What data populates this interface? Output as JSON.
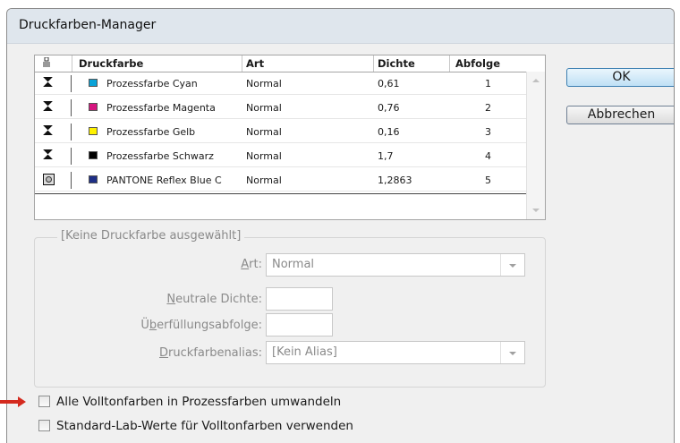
{
  "window": {
    "title": "Druckfarben-Manager"
  },
  "table": {
    "columns": [
      "Druckfarbe",
      "Art",
      "Dichte",
      "Abfolge"
    ],
    "rows": [
      {
        "icon": "process-icon",
        "swatch": "#0aa3d8",
        "name": "Prozessfarbe Cyan",
        "art": "Normal",
        "dichte": "0,61",
        "abfolge": "1"
      },
      {
        "icon": "process-icon",
        "swatch": "#d6157f",
        "name": "Prozessfarbe Magenta",
        "art": "Normal",
        "dichte": "0,76",
        "abfolge": "2"
      },
      {
        "icon": "process-icon",
        "swatch": "#fff200",
        "name": "Prozessfarbe Gelb",
        "art": "Normal",
        "dichte": "0,16",
        "abfolge": "3"
      },
      {
        "icon": "process-icon",
        "swatch": "#000000",
        "name": "Prozessfarbe Schwarz",
        "art": "Normal",
        "dichte": "1,7",
        "abfolge": "4"
      },
      {
        "icon": "spot-icon",
        "swatch": "#1e2f86",
        "name": "PANTONE Reflex Blue C",
        "art": "Normal",
        "dichte": "1,2863",
        "abfolge": "5"
      }
    ]
  },
  "buttons": {
    "ok": "OK",
    "cancel": "Abbrechen"
  },
  "details": {
    "legend": "[Keine Druckfarbe ausgewählt]",
    "art_label": "Art:",
    "art_value": "Normal",
    "dichte_label": "Neutrale Dichte:",
    "dichte_value": "",
    "abfolge_label": "Überfüllungsabfolge:",
    "abfolge_value": "",
    "alias_label": "Druckfarbenalias:",
    "alias_value": "[Kein Alias]"
  },
  "options": {
    "convert_spot": {
      "label": "Alle Volltonfarben in Prozessfarben umwandeln",
      "checked": false
    },
    "standard_lab": {
      "label": "Standard-Lab-Werte für Volltonfarben verwenden",
      "checked": false
    }
  },
  "colors": {
    "annotation_arrow": "#d42a1e"
  }
}
